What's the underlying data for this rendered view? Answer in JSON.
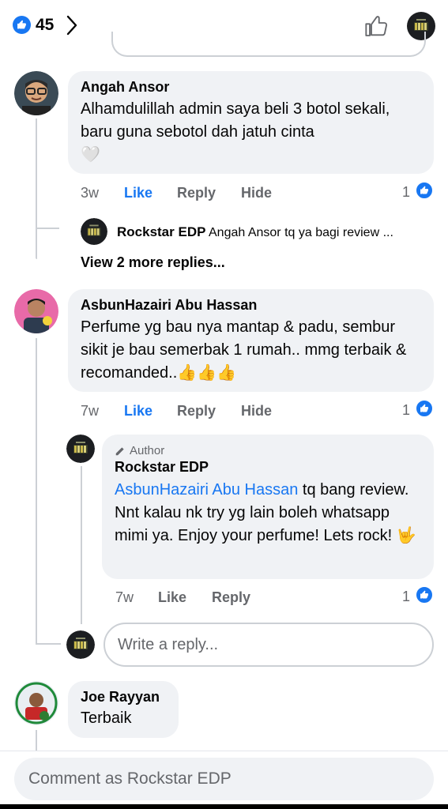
{
  "header": {
    "reaction_count": "45"
  },
  "comments": [
    {
      "author": "Angah Ansor",
      "text": "Alhamdulillah admin saya beli 3 botol sekali, baru guna sebotol dah jatuh cinta",
      "emoji": "🤍",
      "time": "3w",
      "like_label": "Like",
      "reply_label": "Reply",
      "hide_label": "Hide",
      "reaction_count": "1",
      "reply_preview": {
        "author": "Rockstar EDP",
        "text": "Angah Ansor tq ya bagi review ..."
      },
      "view_more": "View 2 more replies..."
    },
    {
      "author": "AsbunHazairi Abu Hassan",
      "text": "Perfume yg bau nya mantap & padu, sembur sikit je bau semerbak 1 rumah.. mmg terbaik & recomanded..",
      "emoji": "👍👍👍",
      "time": "7w",
      "like_label": "Like",
      "reply_label": "Reply",
      "hide_label": "Hide",
      "reaction_count": "1",
      "reply": {
        "tag": "Author",
        "author": "Rockstar EDP",
        "mention": "AsbunHazairi Abu Hassan",
        "text": " tq bang review. Nnt kalau nk try yg lain boleh whatsapp mimi ya. Enjoy your perfume! Lets rock! ",
        "emoji": "🤟",
        "time": "7w",
        "like_label": "Like",
        "reply_label": "Reply",
        "reaction_count": "1"
      },
      "reply_input_placeholder": "Write a reply..."
    },
    {
      "author": "Joe Rayyan",
      "text": "Terbaik"
    }
  ],
  "footer": {
    "comment_placeholder": "Comment as Rockstar EDP"
  },
  "colors": {
    "accent": "#1877f2",
    "bubble": "#f0f2f5",
    "muted": "#65676b"
  }
}
